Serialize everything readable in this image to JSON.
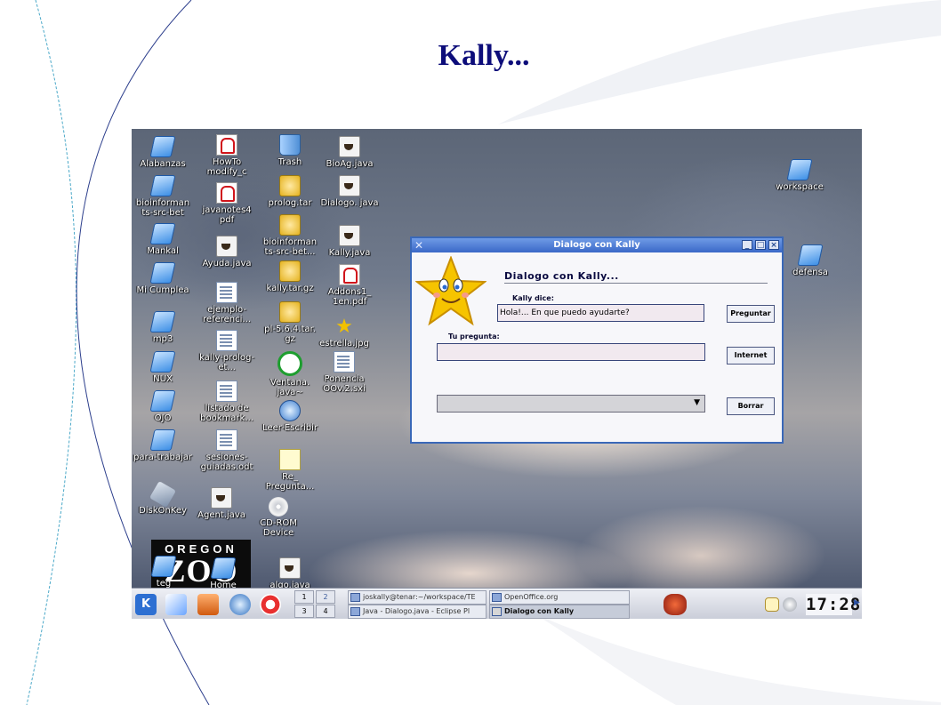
{
  "slide": {
    "title": "Kally..."
  },
  "desktop_icons": [
    {
      "label": "Alabanzas",
      "icon": "folder-icon"
    },
    {
      "label": "bioinforman ts-src-bet",
      "icon": "folder-icon"
    },
    {
      "label": "Mankal",
      "icon": "folder-icon"
    },
    {
      "label": "Mi Cumplea",
      "icon": "folder-icon"
    },
    {
      "label": "mp3",
      "icon": "folder-icon"
    },
    {
      "label": "NUX",
      "icon": "folder-icon"
    },
    {
      "label": "OJO",
      "icon": "folder-icon"
    },
    {
      "label": "para-trabajar",
      "icon": "folder-icon"
    },
    {
      "label": "DiskOnKey",
      "icon": "usb-drive-icon"
    },
    {
      "label": "teg",
      "icon": "folder-icon"
    },
    {
      "label": "HowTo modify_c",
      "icon": "pdf-icon"
    },
    {
      "label": "javanotes4 pdf",
      "icon": "pdf-icon"
    },
    {
      "label": "Ayuda.java",
      "icon": "java-file-icon"
    },
    {
      "label": "ejemplo-referenci...",
      "icon": "document-icon"
    },
    {
      "label": "kally-prolog-et...",
      "icon": "document-icon"
    },
    {
      "label": "listado de bookmark...",
      "icon": "document-icon"
    },
    {
      "label": "sesiones-guiadas.odt",
      "icon": "document-icon"
    },
    {
      "label": "Agent.java",
      "icon": "java-file-icon"
    },
    {
      "label": "Home",
      "icon": "home-folder-icon"
    },
    {
      "label": "Trash",
      "icon": "trash-icon"
    },
    {
      "label": "prolog.tar",
      "icon": "archive-icon"
    },
    {
      "label": "bioinforman ts-src-bet...",
      "icon": "archive-icon"
    },
    {
      "label": "kally.tar.gz",
      "icon": "archive-icon"
    },
    {
      "label": "pl-5.6.4.tar. gz",
      "icon": "archive-icon"
    },
    {
      "label": "Ventana. java~",
      "icon": "backup-file-icon"
    },
    {
      "label": "Leer-Escribir",
      "icon": "web-file-icon"
    },
    {
      "label": "Re_ Pregunta...",
      "icon": "note-icon"
    },
    {
      "label": "CD-ROM Device",
      "icon": "cdrom-icon"
    },
    {
      "label": "algo.java",
      "icon": "java-file-icon"
    },
    {
      "label": "BioAg.java",
      "icon": "java-file-icon"
    },
    {
      "label": "Dialogo. java",
      "icon": "java-file-icon"
    },
    {
      "label": "Kally.java",
      "icon": "java-file-icon"
    },
    {
      "label": "Addons1_ 1en.pdf",
      "icon": "pdf-icon"
    },
    {
      "label": "estrella.jpg",
      "icon": "star-image-icon"
    },
    {
      "label": "Ponencia OOv.2.sxi",
      "icon": "document-icon"
    },
    {
      "label": "workspace",
      "icon": "folder-icon"
    },
    {
      "label": "defensa",
      "icon": "folder-icon"
    }
  ],
  "zoo_logo": {
    "top": "OREGON",
    "main": "ZOO"
  },
  "dialog": {
    "window_title": "Dialogo con Kally",
    "heading": "Dialogo con Kally...",
    "kally_label": "Kally dice:",
    "kally_text": "Hola!... En que puedo ayudarte?",
    "question_label": "Tu pregunta:",
    "question_value": "",
    "combo_value": "",
    "buttons": {
      "ask": "Preguntar",
      "internet": "Internet",
      "clear": "Borrar"
    },
    "win_controls": {
      "minimize": "_",
      "maximize": "□",
      "close": "×"
    }
  },
  "taskbar": {
    "pager": [
      "1",
      "2",
      "3",
      "4"
    ],
    "tasks": [
      {
        "label": "joskally@tenar:~/workspace/TE"
      },
      {
        "label": "OpenOffice.org"
      },
      {
        "label": "Java - Dialogo.java - Eclipse Pl"
      },
      {
        "label": "Dialogo con Kally"
      }
    ],
    "clock": "17:28"
  },
  "colors": {
    "title": "#0d0d7a",
    "dialog_border": "#3a68b8",
    "titlebar": "#3a68c7"
  }
}
